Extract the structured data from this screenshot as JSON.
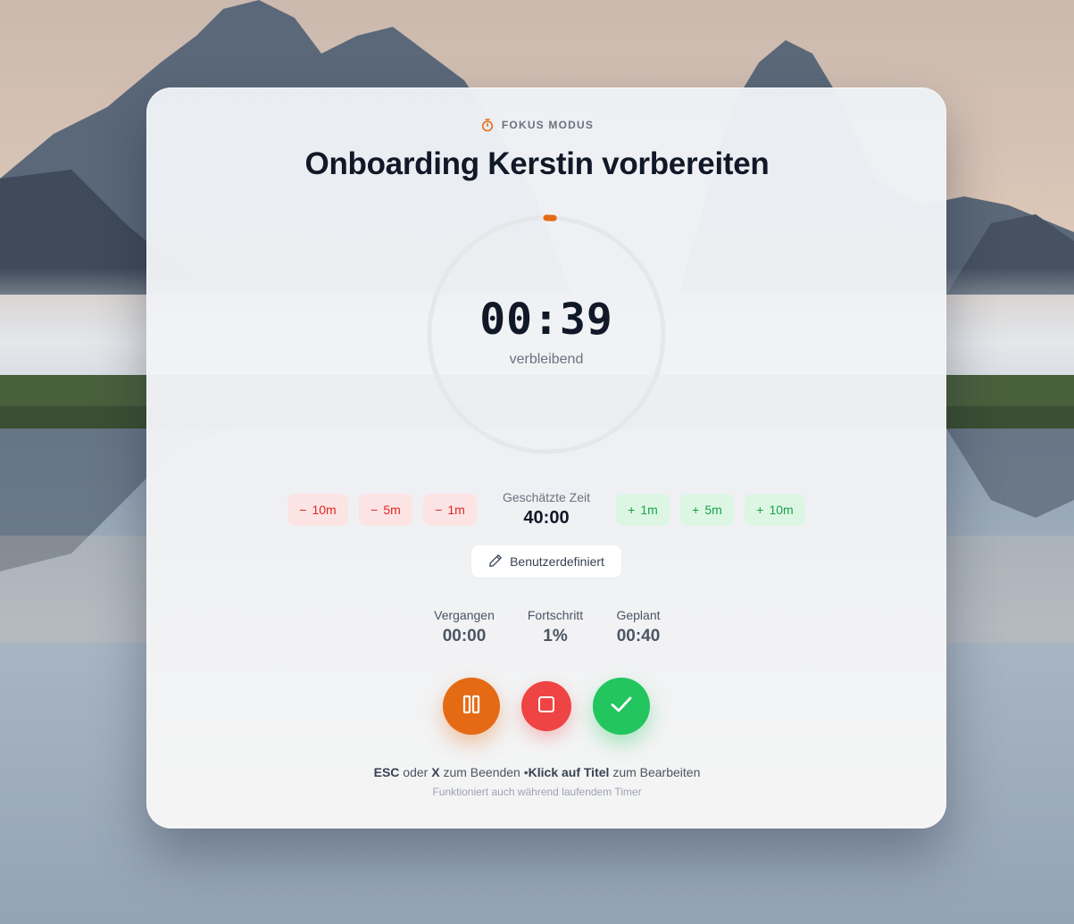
{
  "header": {
    "mode_label": "FOKUS MODUS",
    "mode_icon": "stopwatch-icon",
    "task_title": "Onboarding Kerstin vorbereiten"
  },
  "timer": {
    "remaining": "00:39",
    "remaining_label": "verbleibend",
    "progress_percent": 1
  },
  "adjust": {
    "minus": [
      "10m",
      "5m",
      "1m"
    ],
    "plus": [
      "1m",
      "5m",
      "10m"
    ],
    "minus_symbol": "−",
    "plus_symbol": "+"
  },
  "estimate": {
    "label": "Geschätzte Zeit",
    "value": "40:00"
  },
  "custom_button": {
    "label": "Benutzerdefiniert",
    "icon": "pencil-icon"
  },
  "stats": {
    "elapsed_label": "Vergangen",
    "elapsed_value": "00:00",
    "progress_label": "Fortschritt",
    "progress_value": "1%",
    "planned_label": "Geplant",
    "planned_value": "00:40"
  },
  "controls": {
    "pause_icon": "pause-icon",
    "stop_icon": "stop-icon",
    "complete_icon": "check-icon"
  },
  "hints": {
    "key1": "ESC",
    "or": "oder",
    "key2": "X",
    "end_text": "zum Beenden •",
    "click_title": "Klick auf Titel",
    "edit_text": "zum Bearbeiten",
    "sub": "Funktioniert auch während laufendem Timer"
  },
  "colors": {
    "accent": "#e56a14",
    "stop": "#ef4444",
    "complete": "#22c55e",
    "minus_bg": "#fde4e4",
    "plus_bg": "#ddf6e4"
  }
}
